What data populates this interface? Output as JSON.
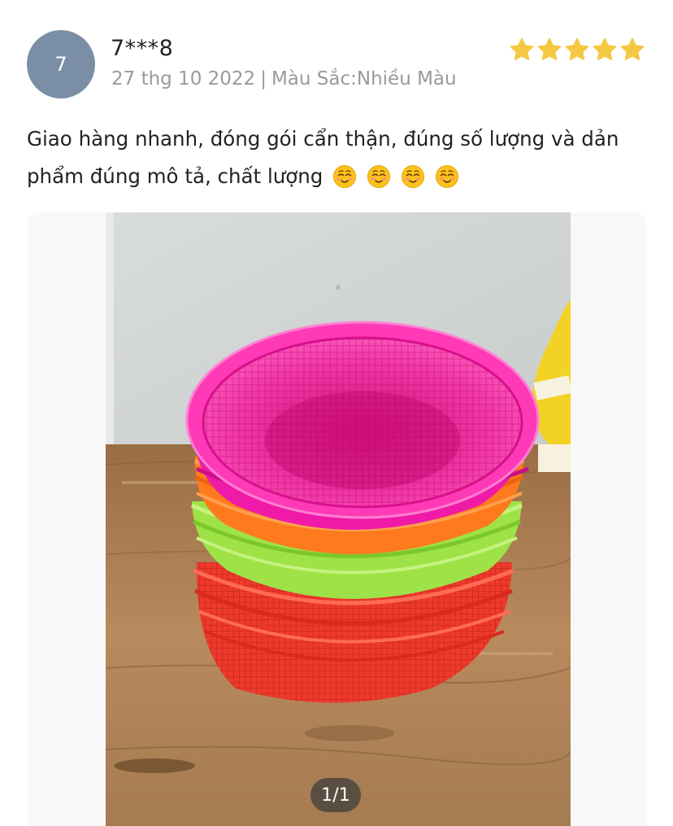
{
  "reviewer": {
    "avatar_initial": "7",
    "username": "7***8",
    "date": "27 thg 10 2022",
    "separator": "|",
    "variant": "Màu Sắc:Nhiều Màu",
    "rating": 5
  },
  "review": {
    "text": "Giao hàng nhanh, đóng gói cẩn thận, đúng số lượng và dản phẩm đúng mô tả, chất lượng",
    "emojis": [
      "relieved-face-icon",
      "relieved-face-icon",
      "relieved-face-icon",
      "relieved-face-icon"
    ]
  },
  "media": {
    "counter": "1/1",
    "content": "photo of stacked plastic baskets in pink, orange, green and red"
  },
  "colors": {
    "star": "#f5c842",
    "avatar_bg": "#7a8fa6",
    "meta_text": "#9a9a9a",
    "pink_basket": "#f01aa8",
    "orange_basket": "#ff7a1a",
    "green_basket": "#9be04a",
    "red_basket": "#f0382c"
  }
}
